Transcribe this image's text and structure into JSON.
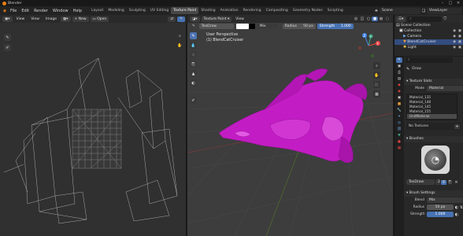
{
  "window": {
    "app_title": "Blender",
    "controls": [
      "–",
      "□",
      "✕"
    ]
  },
  "menu": [
    "File",
    "Edit",
    "Render",
    "Window",
    "Help"
  ],
  "workspaces": [
    "Layout",
    "Modeling",
    "Sculpting",
    "UV Editing",
    "Texture Paint",
    "Shading",
    "Animation",
    "Rendering",
    "Compositing",
    "Geometry Nodes",
    "Scripting"
  ],
  "active_workspace": "Texture Paint",
  "scene": {
    "label": "Scene",
    "view_layer": "ViewLayer"
  },
  "image_editor": {
    "menus": [
      "View",
      "View",
      "Image"
    ],
    "new_label": "New",
    "open_label": "Open"
  },
  "viewport": {
    "mode": "Texture Paint",
    "view_menu": "View",
    "brush_name": "TexDraw",
    "blend": "Mix",
    "radius_label": "Radius",
    "radius_value": "50 px",
    "strength_label": "Strength",
    "strength_value": "1.000",
    "perspective": "User Perspective",
    "object_info": "(1) BlendCatCruiser",
    "axis_x": "X",
    "axis_y": "Y",
    "axis_z": "Z"
  },
  "outliner": {
    "scene_collection": "Scene Collection",
    "items": [
      {
        "label": "Collection",
        "icon": "collection-icon"
      },
      {
        "label": "Camera",
        "icon": "camera-icon"
      },
      {
        "label": "BlendCatCruiser",
        "icon": "mesh-icon",
        "selected": true
      },
      {
        "label": "Light",
        "icon": "light-icon"
      }
    ]
  },
  "properties": {
    "tool_header": "Draw",
    "texture_slots_title": "Texture Slots",
    "mode_label": "Mode",
    "mode_value": "Material",
    "materials": [
      "Material_135",
      "Material_148",
      "Material_145",
      "Material_155",
      "UnitMaterial"
    ],
    "no_textures": "No Textures",
    "brushes_title": "Brushes",
    "brush_name": "TexDraw",
    "brush_users": "2",
    "brush_settings_title": "Brush Settings",
    "blend_label": "Blend",
    "blend_value": "Mix",
    "radius_label": "Radius",
    "radius_value": "50 px",
    "strength_label": "Strength",
    "strength_value": "1.000"
  },
  "colors": {
    "accent": "#4772b3",
    "mesh": "#c21dc4",
    "logo": "#e87d0d"
  }
}
